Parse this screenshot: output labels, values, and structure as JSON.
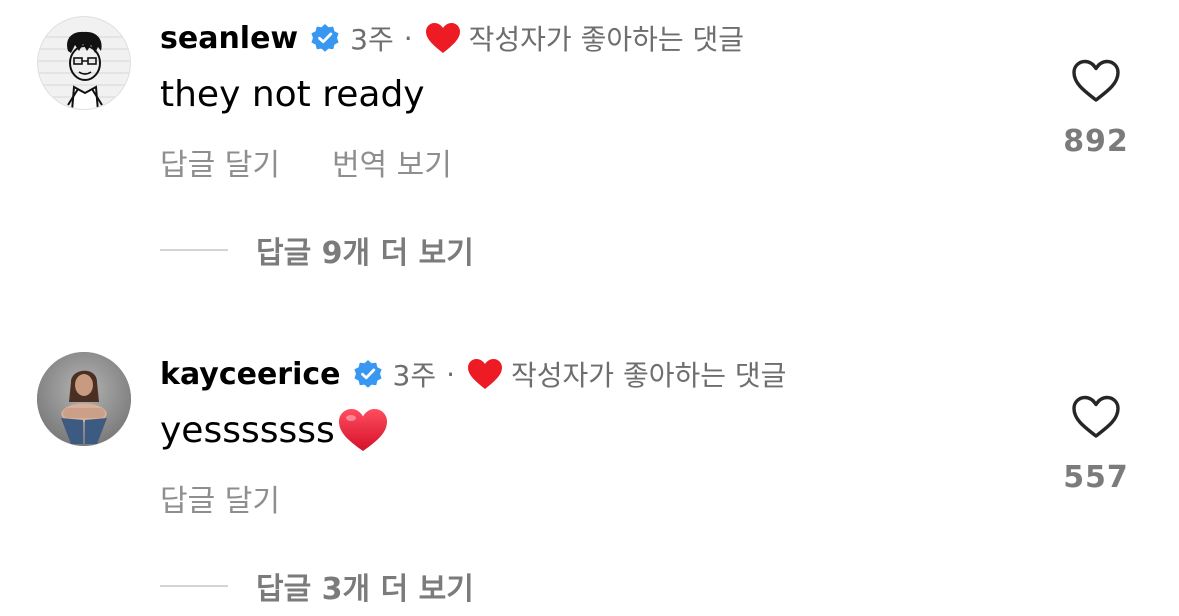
{
  "comments": [
    {
      "username": "seanlew",
      "time": "3주",
      "separator": "·",
      "liked_by_author_label": "작성자가 좋아하는 댓글",
      "text": "they not ready",
      "reply_label": "답글 달기",
      "translate_label": "번역 보기",
      "like_count": "892",
      "view_replies_label": "답글 9개 더 보기",
      "avatar_icon": "line-drawing-portrait",
      "verified_color": "#3897f0",
      "liked_heart_color": "#ed1c24"
    },
    {
      "username": "kayceerice",
      "time": "3주",
      "separator": "·",
      "liked_by_author_label": "작성자가 좋아하는 댓글",
      "text": "yesssssss",
      "text_emoji": "red-heart-emoji",
      "reply_label": "답글 달기",
      "like_count": "557",
      "view_replies_label": "답글 3개 더 보기",
      "avatar_icon": "photo-portrait",
      "verified_color": "#3897f0",
      "liked_heart_color": "#ed1c24"
    }
  ]
}
